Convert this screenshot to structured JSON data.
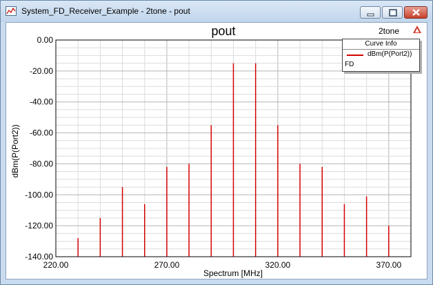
{
  "window": {
    "title": "System_FD_Receiver_Example - 2tone - pout",
    "app_icon": "hfss-plot-icon",
    "buttons": {
      "minimize_icon": "minimize-icon",
      "maximize_icon": "maximize-icon",
      "close_icon": "close-icon"
    }
  },
  "plot": {
    "title": "pout",
    "design_name": "2tone",
    "logo_icon": "ansoft-logo-icon"
  },
  "legend": {
    "header": "Curve Info",
    "entry_label": "dBm(P(Port2))",
    "entry_sub": "FD",
    "entry_color": "#d40000"
  },
  "chart_data": {
    "type": "bar",
    "xlabel": "Spectrum [MHz]",
    "ylabel": "dBm(P(Port2))",
    "xlim": [
      220,
      380
    ],
    "ylim": [
      -140,
      0
    ],
    "x_ticks": [
      "220.00",
      "270.00",
      "320.00",
      "370.00"
    ],
    "y_ticks": [
      "0.00",
      "-20.00",
      "-40.00",
      "-60.00",
      "-80.00",
      "-100.00",
      "-120.00",
      "-140.00"
    ],
    "grid": true,
    "series": [
      {
        "name": "dBm(P(Port2))",
        "color": "#d40000",
        "x": [
          230,
          240,
          250,
          260,
          270,
          280,
          290,
          300,
          310,
          320,
          330,
          340,
          350,
          360,
          370
        ],
        "values": [
          -128,
          -115,
          -95,
          -106,
          -82,
          -80,
          -55,
          -15,
          -15,
          -55,
          -80,
          -82,
          -106,
          -101,
          -120
        ]
      }
    ]
  }
}
